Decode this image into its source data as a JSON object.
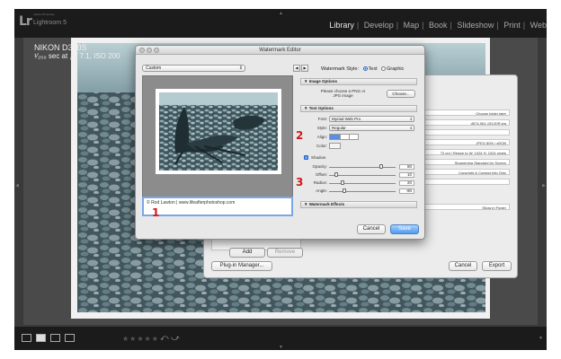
{
  "app": {
    "logo": "Lr",
    "adobe_sub": "Adobe Photoshop",
    "product": "Lightroom 5",
    "modules": [
      "Library",
      "Develop",
      "Map",
      "Book",
      "Slideshow",
      "Print",
      "Web"
    ],
    "active_module": "Library"
  },
  "photo_info": {
    "camera": "NIKON D300S",
    "exposure": "¹⁄₂₅₀ sec at ƒ / 7.1, ISO 200"
  },
  "filmstrip": {
    "stars": "★★★★★"
  },
  "export_dialog": {
    "rows": [
      "Choose folder later",
      "d574-061-153-EIR.jpg",
      "",
      "JPEG 80% / sRGB",
      "72 ppi / Resize to W: 1024 H: 1024 pixels",
      "Sharpening Standard for Screen",
      "Copyright & Contact Info Only",
      "",
      "Show in Finder"
    ],
    "add_label": "Add",
    "remove_label": "Remove",
    "plugin_manager_label": "Plug-in Manager...",
    "cancel_label": "Cancel",
    "export_label": "Export"
  },
  "watermark_editor": {
    "title": "Watermark Editor",
    "preset": "Custom",
    "style_label": "Watermark Style:",
    "style_text": "Text",
    "style_graphic": "Graphic",
    "watermark_text": "© Rod Lawton | www.lifeafterphotoshop.com",
    "image_options": {
      "header": "Image Options",
      "hint": "Please choose a PNG or JPG image",
      "choose_label": "Choose..."
    },
    "text_options": {
      "header": "Text Options",
      "font_label": "Font:",
      "font_value": "Myriad Web Pro",
      "style_label": "Style:",
      "style_value": "Regular",
      "align_label": "Align:",
      "color_label": "Color:"
    },
    "shadow": {
      "label": "Shadow",
      "opacity_label": "Opacity:",
      "opacity_value": "80",
      "offset_label": "Offset:",
      "offset_value": "10",
      "radius_label": "Radius:",
      "radius_value": "20",
      "angle_label": "Angle:",
      "angle_value": "-90"
    },
    "effects_header": "Watermark Effects",
    "cancel_label": "Cancel",
    "save_label": "Save"
  },
  "callouts": [
    "1",
    "2",
    "3"
  ],
  "colors": {
    "callout": "#d4161a",
    "save_button": "#4d9bf0",
    "lr_chrome": "#1b1b1b"
  }
}
